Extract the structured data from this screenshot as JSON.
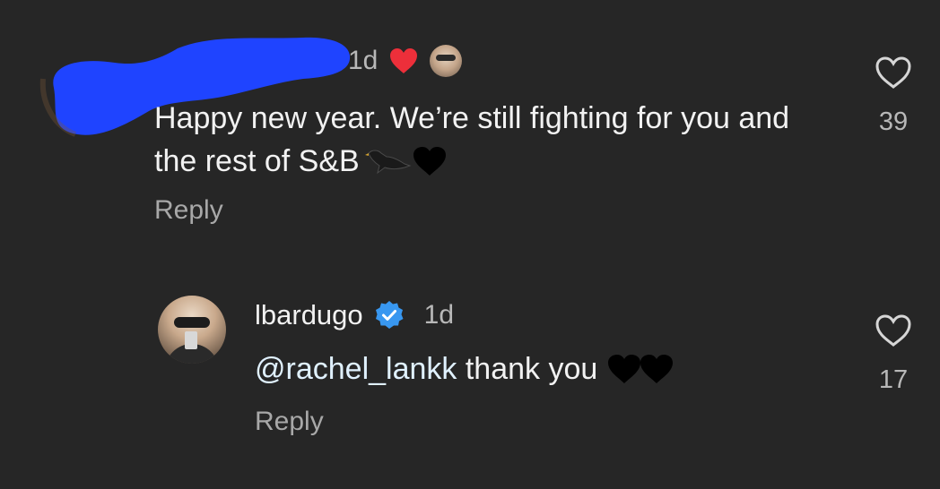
{
  "comment": {
    "time": "1d",
    "text": "Happy new year. We’re still fighting for you and the rest of S&B",
    "reply_label": "Reply",
    "like_count": "39",
    "emoji": [
      "bird-icon",
      "black-heart-icon"
    ],
    "author_redacted_color": "#1f44ff"
  },
  "reply": {
    "username": "lbardugo",
    "time": "1d",
    "mention": "@rachel_lankk",
    "text": " thank you",
    "emoji": [
      "black-heart-icon",
      "black-heart-icon"
    ],
    "reply_label": "Reply",
    "like_count": "17",
    "verified_color": "#3897f0"
  },
  "colors": {
    "background": "#262626",
    "liked_heart": "#ed2f3a"
  }
}
